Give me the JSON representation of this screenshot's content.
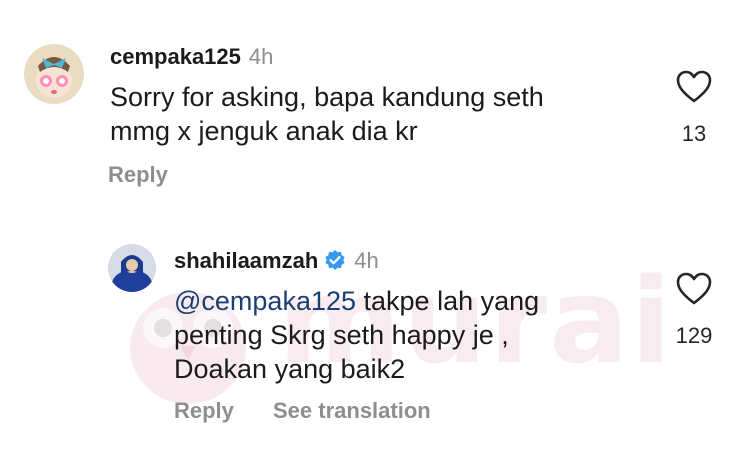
{
  "watermark": {
    "text": "murai"
  },
  "comments": [
    {
      "username": "cempaka125",
      "time": "4h",
      "body_lines": [
        "Sorry for asking, bapa kandung seth",
        "mmg x jenguk anak dia kr"
      ],
      "likes": "13",
      "actions": {
        "reply": "Reply"
      }
    },
    {
      "username": "shahilaamzah",
      "verified": true,
      "time": "4h",
      "mention": "@cempaka125",
      "body_line1_rest": " takpe lah yang",
      "body_lines_rest": [
        "penting Skrg seth happy je ,",
        "Doakan yang baik2"
      ],
      "likes": "129",
      "actions": {
        "reply": "Reply",
        "translate": "See translation"
      }
    }
  ],
  "colors": {
    "text": "#1b1b1b",
    "muted": "#8e8e8e",
    "mention": "#1c3f73",
    "verified": "#3897f0"
  },
  "icons": [
    "heart-icon",
    "verified-badge-icon"
  ]
}
